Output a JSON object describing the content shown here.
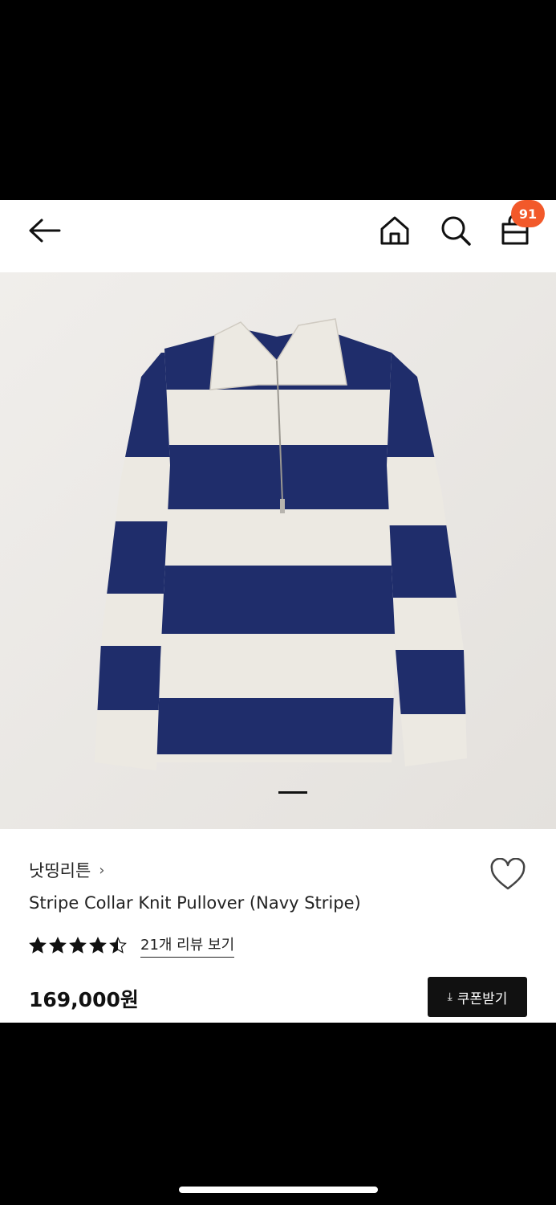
{
  "header": {
    "back_icon": "arrow-left-icon",
    "home_icon": "home-icon",
    "search_icon": "search-icon",
    "cart_icon": "shopping-bag-icon",
    "cart_count": "91",
    "badge_color": "#f2592a"
  },
  "gallery": {
    "current_index": 1,
    "product_colors": {
      "navy": "#1f2d6b",
      "cream": "#ece9e2"
    }
  },
  "product": {
    "brand": "낫띵리튼",
    "brand_chevron": "›",
    "title": "Stripe Collar Knit Pullover (Navy Stripe)",
    "rating": 4.5,
    "rating_max": 5,
    "review_link": "21개 리뷰 보기",
    "price": "169,000원",
    "wishlist_icon": "heart-icon"
  },
  "actions": {
    "coupon_icon": "download-icon",
    "coupon_glyph": "⤓",
    "coupon_label": "쿠폰받기"
  }
}
